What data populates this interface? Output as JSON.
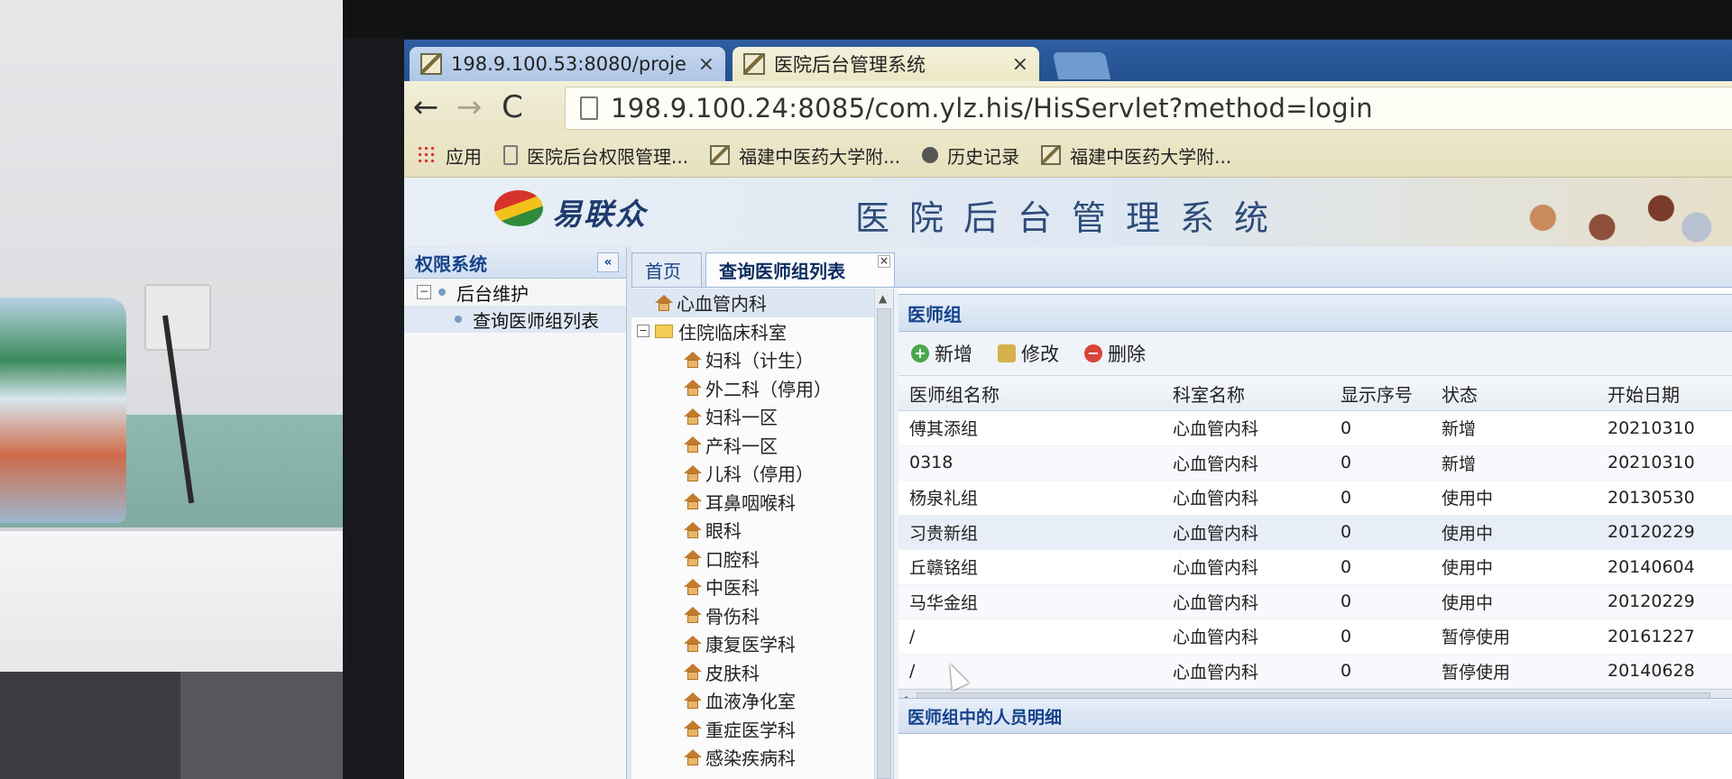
{
  "browser": {
    "tabs": [
      {
        "title": "198.9.100.53:8080/proje",
        "close": "×"
      },
      {
        "title": "医院后台管理系统",
        "close": "×"
      }
    ],
    "nav": {
      "back": "←",
      "forward": "→",
      "reload": "C"
    },
    "url": "198.9.100.24:8085/com.ylz.his/HisServlet?method=login",
    "bookmarks": [
      {
        "label": "应用",
        "icon": "apps-grid-icon"
      },
      {
        "label": "医院后台权限管理...",
        "icon": "page-icon"
      },
      {
        "label": "福建中医药大学附...",
        "icon": "site-favicon-icon"
      },
      {
        "label": "历史记录",
        "icon": "history-clock-icon"
      },
      {
        "label": "福建中医药大学附...",
        "icon": "site-favicon-icon"
      }
    ]
  },
  "app": {
    "logo_text": "易联众",
    "system_title": "医院后台管理系统"
  },
  "sidebar": {
    "title": "权限系统",
    "collapse": "«",
    "tree": {
      "root": "后台维护",
      "child": "查询医师组列表"
    }
  },
  "main_tabs": [
    {
      "label": "首页"
    },
    {
      "label": "查询医师组列表",
      "close": "×"
    }
  ],
  "dept_tree": {
    "root": "心血管内科",
    "group": "住院临床科室",
    "items": [
      "妇科（计生）",
      "外二科（停用）",
      "妇科一区",
      "产科一区",
      "儿科（停用）",
      "耳鼻咽喉科",
      "眼科",
      "口腔科",
      "中医科",
      "骨伤科",
      "康复医学科",
      "皮肤科",
      "血液净化室",
      "重症医学科",
      "感染疾病科"
    ]
  },
  "grid_panel": {
    "title": "医师组",
    "toolbar": {
      "add": "新增",
      "edit": "修改",
      "delete": "删除"
    },
    "columns": [
      "医师组名称",
      "科室名称",
      "显示序号",
      "状态",
      "开始日期"
    ],
    "rows": [
      [
        "傅其添组",
        "心血管内科",
        "0",
        "新增",
        "20210310"
      ],
      [
        "0318",
        "心血管内科",
        "0",
        "新增",
        "20210310"
      ],
      [
        "杨泉礼组",
        "心血管内科",
        "0",
        "使用中",
        "20130530"
      ],
      [
        "习贵新组",
        "心血管内科",
        "0",
        "使用中",
        "20120229"
      ],
      [
        "丘赣铭组",
        "心血管内科",
        "0",
        "使用中",
        "20140604"
      ],
      [
        "马华金组",
        "心血管内科",
        "0",
        "使用中",
        "20120229"
      ],
      [
        "/",
        "心血管内科",
        "0",
        "暂停使用",
        "20161227"
      ],
      [
        "/",
        "心血管内科",
        "0",
        "暂停使用",
        "20140628"
      ]
    ],
    "detail_title": "医师组中的人员明细"
  }
}
